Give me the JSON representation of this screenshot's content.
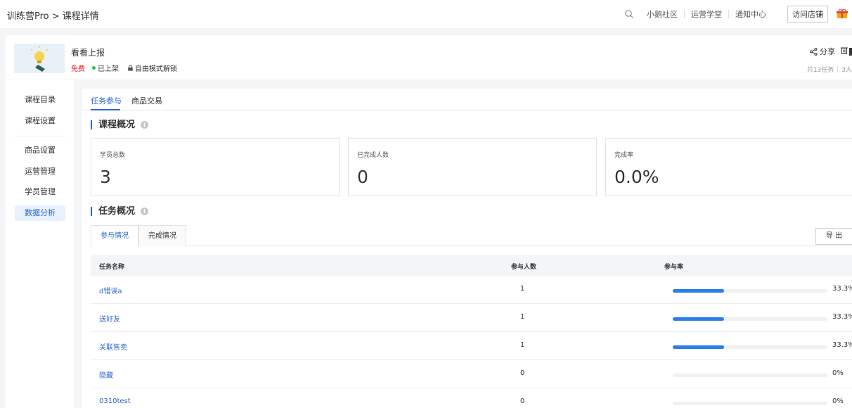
{
  "header": {
    "breadcrumb": "训练营Pro > 课程详情",
    "links": [
      "小鹅社区",
      "运营学堂",
      "通知中心"
    ],
    "visit_button": "访问店铺"
  },
  "course": {
    "title": "看看上报",
    "price_tag": "免费",
    "status": "已上架",
    "unlock_mode": "自由模式解锁",
    "share": "分享",
    "meta_tasks": "共13任务",
    "meta_people": "3人"
  },
  "sidebar": {
    "items": [
      {
        "label": "课程目录"
      },
      {
        "label": "课程设置"
      },
      {
        "label": "商品设置"
      },
      {
        "label": "运营管理"
      },
      {
        "label": "学员管理"
      },
      {
        "label": "数据分析"
      }
    ],
    "active_index": 5
  },
  "tabs": [
    {
      "label": "任务参与"
    },
    {
      "label": "商品交易"
    }
  ],
  "overview": {
    "title": "课程概况",
    "stats": [
      {
        "label": "学员总数",
        "value": "3"
      },
      {
        "label": "已完成人数",
        "value": "0"
      },
      {
        "label": "完成率",
        "value": "0.0%"
      }
    ]
  },
  "tasks": {
    "title": "任务概况",
    "subtabs": [
      {
        "label": "参与情况"
      },
      {
        "label": "完成情况"
      }
    ],
    "export_label": "导 出",
    "columns": {
      "name": "任务名称",
      "count": "参与人数",
      "rate": "参与率"
    },
    "rows": [
      {
        "name": "d错误a",
        "count": "1",
        "rate": "33.3%",
        "rate_value": 0.333
      },
      {
        "name": "送好友",
        "count": "1",
        "rate": "33.3%",
        "rate_value": 0.333
      },
      {
        "name": "关联售卖",
        "count": "1",
        "rate": "33.3%",
        "rate_value": 0.333
      },
      {
        "name": "隐藏",
        "count": "0",
        "rate": "0%",
        "rate_value": 0
      },
      {
        "name": "0310test",
        "count": "0",
        "rate": "0%",
        "rate_value": 0
      }
    ]
  },
  "colors": {
    "accent": "#2b68d2",
    "bar": "#2b7ee8",
    "free": "#e02424",
    "online_dot": "#27c346"
  }
}
